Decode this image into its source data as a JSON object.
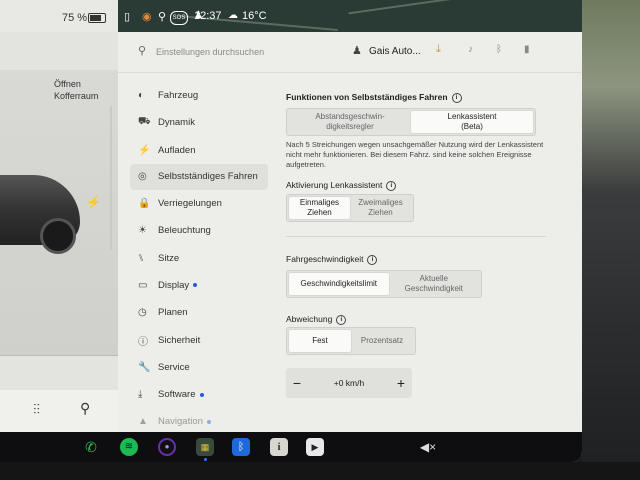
{
  "status": {
    "battery_pct": "75 %",
    "time": "12:37",
    "temperature": "16°C",
    "sos_label": "SOS"
  },
  "car_panel": {
    "trunk_line1": "Öffnen",
    "trunk_line2": "Kofferraum"
  },
  "search": {
    "placeholder": "Einstellungen durchsuchen"
  },
  "profile": {
    "name": "Gais Auto..."
  },
  "menu": [
    {
      "label": "Fahrzeug",
      "icon": "toggle-icon",
      "glyph": "◐"
    },
    {
      "label": "Dynamik",
      "icon": "car-icon",
      "glyph": "⛟"
    },
    {
      "label": "Aufladen",
      "icon": "bolt-icon",
      "glyph": "⚡"
    },
    {
      "label": "Selbstständiges Fahren",
      "icon": "steering-wheel-icon",
      "glyph": "◎",
      "active": true
    },
    {
      "label": "Verriegelungen",
      "icon": "lock-icon",
      "glyph": "🔒"
    },
    {
      "label": "Beleuchtung",
      "icon": "light-icon",
      "glyph": "☀"
    },
    {
      "label": "Sitze",
      "icon": "seat-icon",
      "glyph": "⑊"
    },
    {
      "label": "Display",
      "icon": "display-icon",
      "glyph": "▭",
      "dot": true
    },
    {
      "label": "Planen",
      "icon": "clock-icon",
      "glyph": "◷"
    },
    {
      "label": "Sicherheit",
      "icon": "shield-icon",
      "glyph": "ⓘ"
    },
    {
      "label": "Service",
      "icon": "wrench-icon",
      "glyph": "🔧"
    },
    {
      "label": "Software",
      "icon": "download-icon",
      "glyph": "⤓",
      "dot": true
    },
    {
      "label": "Navigation",
      "icon": "navigation-icon",
      "glyph": "▲",
      "dot": true,
      "faded": true
    }
  ],
  "content": {
    "autopilot_title": "Funktionen von Selbstständiges Fahren",
    "autopilot_options": [
      {
        "label": "Abstandsgeschwin-\ndigkeitsregler",
        "selected": false
      },
      {
        "label": "Lenkassistent\n(Beta)",
        "selected": true
      }
    ],
    "autopilot_desc": "Nach 5 Streichungen wegen unsachgemäßer Nutzung wird der Lenkassistent nicht mehr funktionieren. Bei diesem Fahrz. sind keine solchen Ereignisse aufgetreten.",
    "activation_title": "Aktivierung Lenkassistent",
    "activation_options": [
      {
        "label": "Einmaliges\nZiehen",
        "selected": true
      },
      {
        "label": "Zweimaliges\nZiehen",
        "selected": false
      }
    ],
    "speed_title": "Fahrgeschwindigkeit",
    "speed_options": [
      {
        "label": "Geschwindigkeitslimit",
        "selected": true
      },
      {
        "label": "Aktuelle\nGeschwindigkeit",
        "selected": false
      }
    ],
    "offset_title": "Abweichung",
    "offset_options": [
      {
        "label": "Fest",
        "selected": true
      },
      {
        "label": "Prozentsatz",
        "selected": false
      }
    ],
    "offset_value": "+0 km/h",
    "minus": "−",
    "plus": "+"
  },
  "dock": {
    "mute_label": "◀×"
  },
  "colors": {
    "accent_blue": "#2a58d8",
    "download_orange": "#e0912a",
    "phone_green": "#27c24c",
    "spotify_green": "#1db954"
  }
}
